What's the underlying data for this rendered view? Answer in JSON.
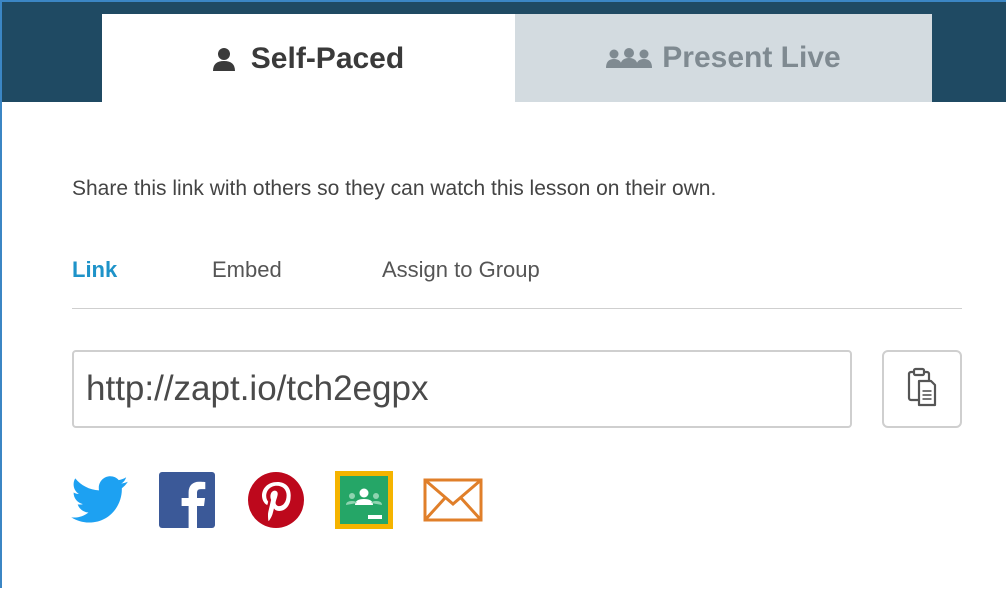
{
  "tabs": {
    "self_paced": {
      "label": "Self-Paced",
      "icon": "person-icon"
    },
    "present_live": {
      "label": "Present Live",
      "icon": "group-icon"
    }
  },
  "description": "Share this link with others so they can watch this lesson on their own.",
  "subtabs": [
    {
      "label": "Link",
      "active": true
    },
    {
      "label": "Embed",
      "active": false
    },
    {
      "label": "Assign to Group",
      "active": false
    }
  ],
  "link": {
    "value": "http://zapt.io/tch2egpx"
  },
  "copy_button": {
    "icon": "clipboard-icon"
  },
  "share_icons": [
    "twitter-icon",
    "facebook-icon",
    "pinterest-icon",
    "google-classroom-icon",
    "email-icon"
  ],
  "colors": {
    "header_bg": "#1f4a63",
    "inactive_tab_bg": "#d3dbe0",
    "accent": "#1e93c9",
    "twitter": "#1da1f2",
    "facebook": "#3b5998",
    "pinterest": "#bd081c",
    "classroom_border": "#f5b400",
    "classroom_bg": "#25a667",
    "email": "#e07f2a"
  }
}
